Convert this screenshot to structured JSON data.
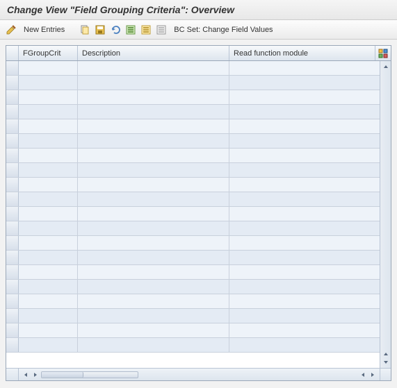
{
  "header": {
    "title": "Change View \"Field Grouping Criteria\": Overview"
  },
  "toolbar": {
    "new_entries_label": "New Entries",
    "bcset_label": "BC Set: Change Field Values"
  },
  "table": {
    "columns": {
      "fgroupcrit": "FGroupCrit",
      "description": "Description",
      "read_function_module": "Read function module"
    },
    "rows": [
      {
        "fgroupcrit": "",
        "description": "",
        "read_function_module": ""
      },
      {
        "fgroupcrit": "",
        "description": "",
        "read_function_module": ""
      },
      {
        "fgroupcrit": "",
        "description": "",
        "read_function_module": ""
      },
      {
        "fgroupcrit": "",
        "description": "",
        "read_function_module": ""
      },
      {
        "fgroupcrit": "",
        "description": "",
        "read_function_module": ""
      },
      {
        "fgroupcrit": "",
        "description": "",
        "read_function_module": ""
      },
      {
        "fgroupcrit": "",
        "description": "",
        "read_function_module": ""
      },
      {
        "fgroupcrit": "",
        "description": "",
        "read_function_module": ""
      },
      {
        "fgroupcrit": "",
        "description": "",
        "read_function_module": ""
      },
      {
        "fgroupcrit": "",
        "description": "",
        "read_function_module": ""
      },
      {
        "fgroupcrit": "",
        "description": "",
        "read_function_module": ""
      },
      {
        "fgroupcrit": "",
        "description": "",
        "read_function_module": ""
      },
      {
        "fgroupcrit": "",
        "description": "",
        "read_function_module": ""
      },
      {
        "fgroupcrit": "",
        "description": "",
        "read_function_module": ""
      },
      {
        "fgroupcrit": "",
        "description": "",
        "read_function_module": ""
      },
      {
        "fgroupcrit": "",
        "description": "",
        "read_function_module": ""
      },
      {
        "fgroupcrit": "",
        "description": "",
        "read_function_module": ""
      },
      {
        "fgroupcrit": "",
        "description": "",
        "read_function_module": ""
      },
      {
        "fgroupcrit": "",
        "description": "",
        "read_function_module": ""
      },
      {
        "fgroupcrit": "",
        "description": "",
        "read_function_module": ""
      }
    ]
  },
  "icons": {
    "edit": "edit-icon",
    "copy": "copy-icon",
    "save": "save-icon",
    "undo": "undo-icon",
    "select_all": "select-all-icon",
    "select_block": "select-block-icon",
    "deselect": "deselect-icon",
    "config": "config-icon"
  },
  "colors": {
    "header_bg": "#e8e8e8",
    "row_odd": "#eef3f9",
    "row_even": "#e4ebf4",
    "border": "#9aa7b8"
  }
}
